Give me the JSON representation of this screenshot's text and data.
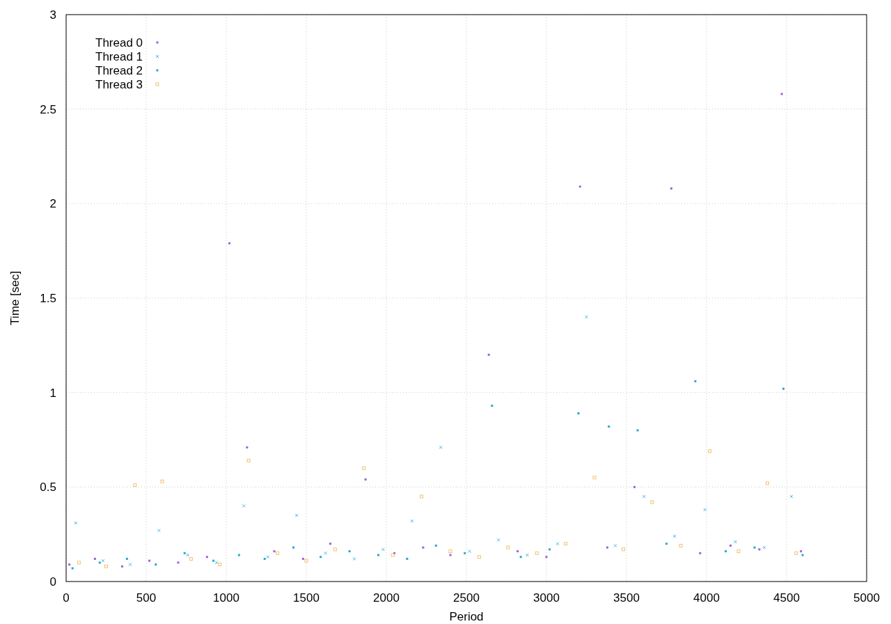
{
  "chart_data": {
    "type": "scatter",
    "grid": true,
    "legend": true,
    "xlabel": "Period",
    "ylabel": "Time [sec]",
    "xlim": [
      0,
      5000
    ],
    "ylim": [
      0,
      3
    ],
    "xticks": [
      0,
      500,
      1000,
      1500,
      2000,
      2500,
      3000,
      3500,
      4000,
      4500,
      5000
    ],
    "yticks": [
      0,
      {
        "value": 0.5,
        "label": "0.5"
      },
      1,
      {
        "value": 1.5,
        "label": "1.5"
      },
      2,
      {
        "value": 2.5,
        "label": "2.5"
      },
      3
    ],
    "series": [
      {
        "name": "Thread 0",
        "color": "#a060e0",
        "x": [
          20,
          180,
          350,
          520,
          700,
          880,
          1020,
          1130,
          1300,
          1480,
          1650,
          1870,
          2050,
          2230,
          2400,
          2640,
          2820,
          3000,
          3210,
          3380,
          3550,
          3780,
          3960,
          4150,
          4330,
          4470,
          4590
        ],
        "values": [
          0.09,
          0.12,
          0.08,
          0.11,
          0.1,
          0.13,
          1.79,
          0.71,
          0.16,
          0.12,
          0.2,
          0.54,
          0.15,
          0.18,
          0.14,
          1.2,
          0.16,
          0.13,
          2.09,
          0.18,
          0.5,
          2.08,
          0.15,
          0.19,
          0.17,
          2.58,
          0.16
        ]
      },
      {
        "name": "Thread 1",
        "color": "#4db8e0",
        "x": [
          60,
          230,
          400,
          580,
          760,
          940,
          1110,
          1260,
          1440,
          1620,
          1800,
          1980,
          2160,
          2340,
          2520,
          2700,
          2880,
          3070,
          3250,
          3430,
          3610,
          3800,
          3990,
          4180,
          4360,
          4530
        ],
        "values": [
          0.31,
          0.11,
          0.09,
          0.27,
          0.14,
          0.1,
          0.4,
          0.13,
          0.35,
          0.15,
          0.12,
          0.17,
          0.32,
          0.71,
          0.16,
          0.22,
          0.14,
          0.2,
          1.4,
          0.19,
          0.45,
          0.24,
          0.38,
          0.21,
          0.18,
          0.45
        ]
      },
      {
        "name": "Thread 2",
        "color": "#28a8c8",
        "x": [
          40,
          210,
          380,
          560,
          740,
          920,
          1080,
          1240,
          1420,
          1590,
          1770,
          1950,
          2130,
          2310,
          2490,
          2660,
          2840,
          3020,
          3200,
          3390,
          3570,
          3750,
          3930,
          4120,
          4300,
          4480,
          4600
        ],
        "values": [
          0.07,
          0.1,
          0.12,
          0.09,
          0.15,
          0.11,
          0.14,
          0.12,
          0.18,
          0.13,
          0.16,
          0.14,
          0.12,
          0.19,
          0.15,
          0.93,
          0.13,
          0.17,
          0.89,
          0.82,
          0.8,
          0.2,
          1.06,
          0.16,
          0.18,
          1.02,
          0.14
        ]
      },
      {
        "name": "Thread 3",
        "color": "#f0c070",
        "x": [
          80,
          250,
          430,
          600,
          780,
          960,
          1140,
          1320,
          1500,
          1680,
          1860,
          2040,
          2220,
          2400,
          2580,
          2760,
          2940,
          3120,
          3300,
          3480,
          3660,
          3840,
          4020,
          4200,
          4380,
          4560
        ],
        "values": [
          0.1,
          0.08,
          0.51,
          0.53,
          0.12,
          0.09,
          0.64,
          0.15,
          0.11,
          0.17,
          0.6,
          0.14,
          0.45,
          0.16,
          0.13,
          0.18,
          0.15,
          0.2,
          0.55,
          0.17,
          0.42,
          0.19,
          0.69,
          0.16,
          0.52,
          0.15
        ]
      }
    ]
  }
}
